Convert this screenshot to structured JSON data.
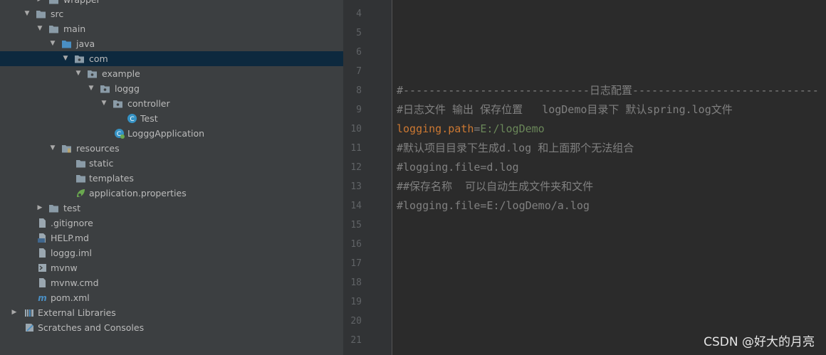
{
  "project_tree": {
    "items": [
      {
        "label": "wrapper",
        "kind": "folder"
      },
      {
        "label": "src",
        "kind": "folder"
      },
      {
        "label": "main",
        "kind": "folder"
      },
      {
        "label": "java",
        "kind": "folder-source"
      },
      {
        "label": "com",
        "kind": "package",
        "selected": true
      },
      {
        "label": "example",
        "kind": "package"
      },
      {
        "label": "loggg",
        "kind": "package"
      },
      {
        "label": "controller",
        "kind": "package"
      },
      {
        "label": "Test",
        "kind": "class"
      },
      {
        "label": "LogggApplication",
        "kind": "spring-app-class"
      },
      {
        "label": "resources",
        "kind": "folder-resources"
      },
      {
        "label": "static",
        "kind": "folder"
      },
      {
        "label": "templates",
        "kind": "folder"
      },
      {
        "label": "application.properties",
        "kind": "spring-properties"
      },
      {
        "label": "test",
        "kind": "folder"
      },
      {
        "label": ".gitignore",
        "kind": "file"
      },
      {
        "label": "HELP.md",
        "kind": "markdown"
      },
      {
        "label": "loggg.iml",
        "kind": "file"
      },
      {
        "label": "mvnw",
        "kind": "shell"
      },
      {
        "label": "mvnw.cmd",
        "kind": "file"
      },
      {
        "label": "pom.xml",
        "kind": "maven"
      },
      {
        "label": "External Libraries",
        "kind": "libraries"
      },
      {
        "label": "Scratches and Consoles",
        "kind": "scratches"
      }
    ]
  },
  "editor": {
    "line_numbers": [
      "4",
      "5",
      "6",
      "7",
      "8",
      "9",
      "10",
      "11",
      "12",
      "13",
      "14",
      "15",
      "16",
      "17",
      "18",
      "19",
      "20",
      "21"
    ],
    "lines": {
      "l8": "#-----------------------------日志配置-----------------------------",
      "l9": "#日志文件 输出 保存位置   logDemo目录下 默认spring.log文件",
      "l10_key": "logging.path",
      "l10_eq": "=",
      "l10_val": "E:/logDemo",
      "l11": "#默认项目目录下生成d.log 和上面那个无法组合",
      "l12": "#logging.file=d.log",
      "l13": "##保存名称  可以自动生成文件夹和文件",
      "l14": "#logging.file=E:/logDemo/a.log"
    }
  },
  "watermark": "CSDN @好大的月亮",
  "colors": {
    "tree_background": "#3c3f41",
    "selection": "#0d293e",
    "editor_background": "#2b2b2b",
    "gutter": "#313335",
    "comment": "#808080",
    "property_key": "#cc7832",
    "property_value": "#6a8759",
    "folder_icon": "#8a9ba7",
    "source_folder_icon": "#4a8fc4",
    "class_icon": "#3592c4"
  }
}
